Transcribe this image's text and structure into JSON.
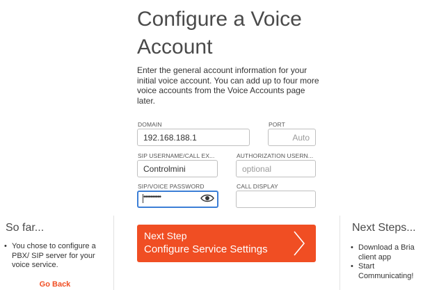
{
  "page": {
    "title_line1": "Configure a Voice",
    "title_line2": "Account",
    "intro": "Enter the general account information for your initial voice account. You can add up to four more voice accounts from the Voice Accounts page later."
  },
  "form": {
    "domain": {
      "label": "DOMAIN",
      "value": "192.168.188.1"
    },
    "port": {
      "label": "PORT",
      "placeholder": "Auto"
    },
    "sip_username": {
      "label": "SIP USERNAME/CALL EX...",
      "value": "Controlmini"
    },
    "auth_username": {
      "label": "AUTHORIZATION USERN...",
      "placeholder": "optional"
    },
    "password": {
      "label": "SIP/VOICE PASSWORD",
      "masked": "••••••••••"
    },
    "call_display": {
      "label": "CALL DISPLAY",
      "value": ""
    }
  },
  "next_button": {
    "line1": "Next Step",
    "line2": "Configure Service Settings",
    "color": "#f04e23"
  },
  "so_far": {
    "title": "So far...",
    "items": [
      "You chose to configure a PBX/ SIP server for your voice service."
    ],
    "go_back": "Go Back"
  },
  "next_steps": {
    "title": "Next Steps...",
    "items": [
      "Download a Bria client app",
      "Start Communicating!"
    ]
  },
  "icons": {
    "reveal_password": "eye-icon",
    "next": "chevron-right-icon"
  }
}
